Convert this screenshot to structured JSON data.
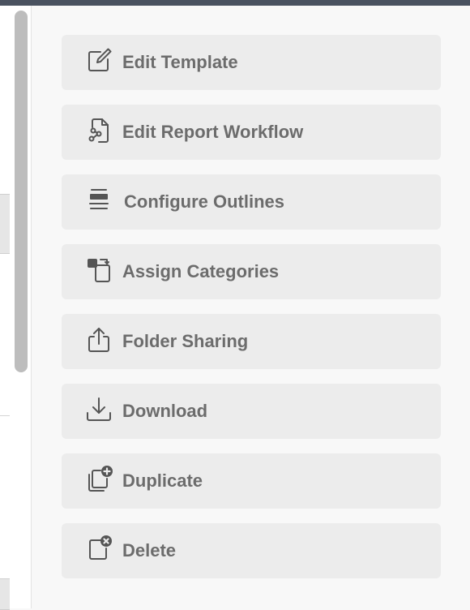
{
  "menu": {
    "items": [
      {
        "label": "Edit Template",
        "icon": "edit-icon"
      },
      {
        "label": "Edit Report Workflow",
        "icon": "workflow-icon"
      },
      {
        "label": "Configure Outlines",
        "icon": "outline-icon"
      },
      {
        "label": "Assign Categories",
        "icon": "categories-icon"
      },
      {
        "label": "Folder Sharing",
        "icon": "share-icon"
      },
      {
        "label": "Download",
        "icon": "download-icon"
      },
      {
        "label": "Duplicate",
        "icon": "duplicate-icon"
      },
      {
        "label": "Delete",
        "icon": "delete-icon"
      }
    ]
  },
  "colors": {
    "button_bg": "#ececec",
    "label": "#6c6c6c",
    "icon": "#555555",
    "topbar": "#4a5260"
  }
}
